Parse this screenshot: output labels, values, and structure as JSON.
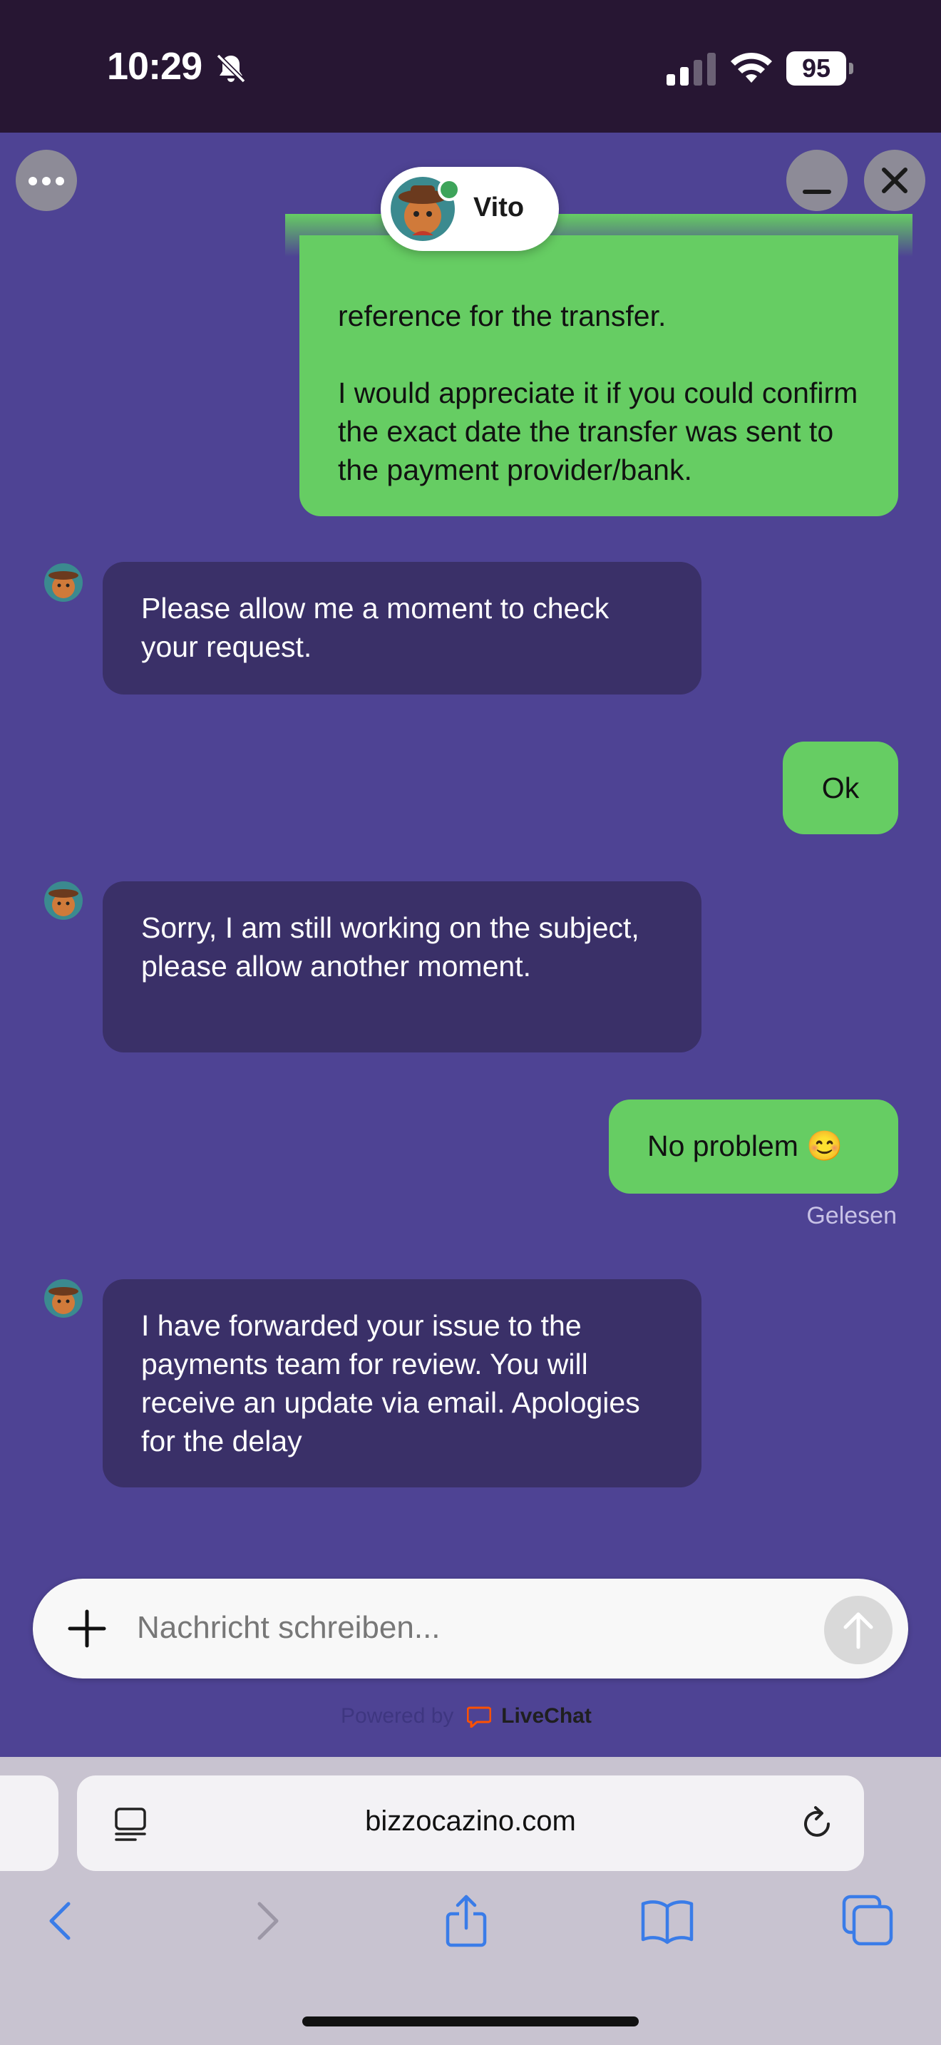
{
  "status_bar": {
    "time": "10:29",
    "battery": "95"
  },
  "chat": {
    "agent_name": "Vito",
    "messages": [
      {
        "from": "visitor",
        "text": "reference for the transfer.\n\nI would appreciate it if you could confirm the exact date the transfer was sent to the payment provider/bank."
      },
      {
        "from": "agent",
        "text": "Please allow me a moment to check your request."
      },
      {
        "from": "visitor",
        "text": "Ok"
      },
      {
        "from": "agent",
        "text": "Sorry, I am still working on the subject, please allow another moment."
      },
      {
        "from": "visitor",
        "text": "No problem 😊"
      },
      {
        "from": "agent",
        "text": "I have forwarded your issue to the payments team for review. You will receive an update via email. Apologies for the delay"
      }
    ],
    "read_status": "Gelesen",
    "composer": {
      "placeholder": "Nachricht schreiben..."
    },
    "powered_by": "Powered by",
    "brand": "LiveChat"
  },
  "browser": {
    "url": "bizzocazino.com"
  },
  "colors": {
    "background": "#4e4394",
    "visitor_bubble": "#66cd63",
    "agent_bubble": "#3a3068",
    "status_bar": "#271633"
  }
}
